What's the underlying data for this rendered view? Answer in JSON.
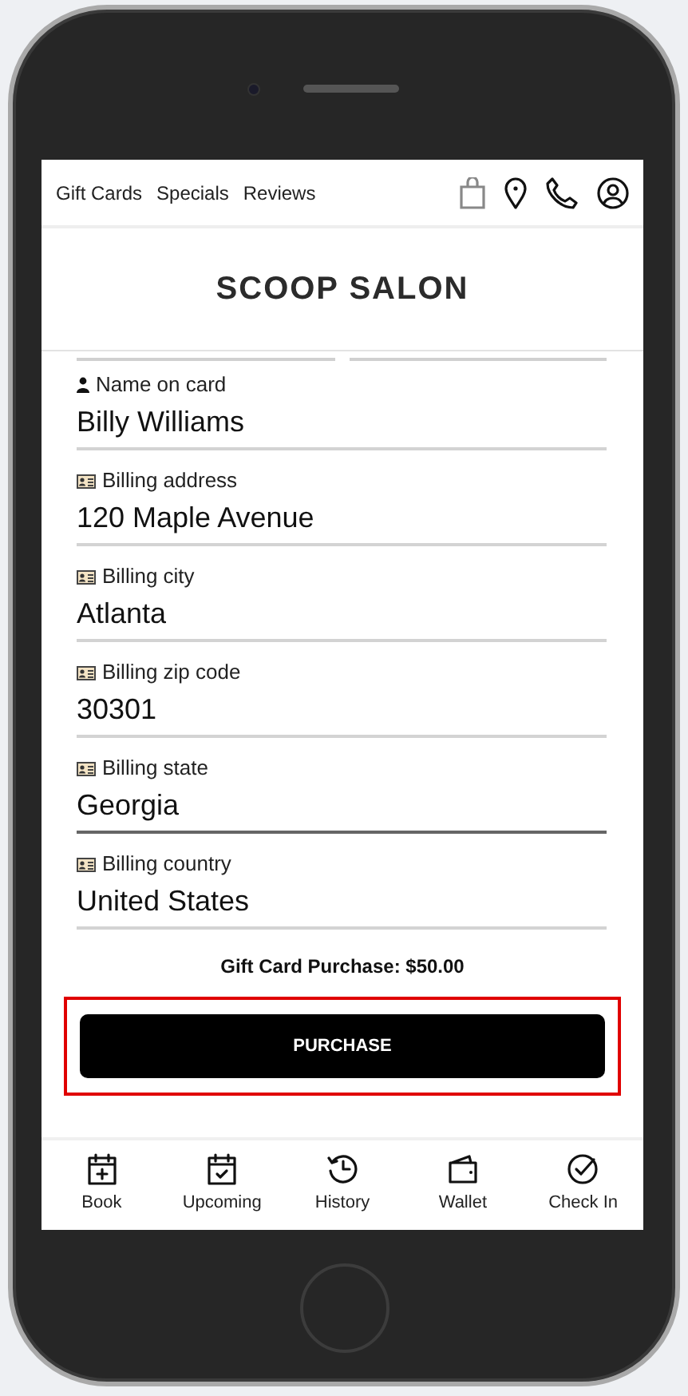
{
  "top_nav": {
    "links": [
      "Gift Cards",
      "Specials",
      "Reviews"
    ],
    "icons": [
      {
        "kind": "bag"
      },
      {
        "kind": "pin"
      },
      {
        "kind": "phone"
      },
      {
        "kind": "user"
      }
    ]
  },
  "logo": "SCOOP SALON",
  "fields": [
    {
      "kind": "person",
      "label": "Name on card",
      "value": "Billy Williams",
      "focused": false
    },
    {
      "kind": "id-card",
      "label": "Billing address",
      "value": "120 Maple Avenue",
      "focused": false
    },
    {
      "kind": "id-card",
      "label": "Billing city",
      "value": "Atlanta",
      "focused": false
    },
    {
      "kind": "id-card",
      "label": "Billing zip code",
      "value": "30301",
      "focused": false
    },
    {
      "kind": "id-card",
      "label": "Billing state",
      "value": "Georgia",
      "focused": true
    },
    {
      "kind": "id-card",
      "label": "Billing country",
      "value": "United States",
      "focused": false
    }
  ],
  "total": "Gift Card Purchase: $50.00",
  "purchase_button": {
    "label": "PURCHASE",
    "highlighted": true
  },
  "bottom_nav": [
    {
      "kind": "book",
      "label": "Book"
    },
    {
      "kind": "upcoming",
      "label": "Upcoming"
    },
    {
      "kind": "history",
      "label": "History"
    },
    {
      "kind": "wallet",
      "label": "Wallet"
    },
    {
      "kind": "checkin",
      "label": "Check In"
    }
  ]
}
